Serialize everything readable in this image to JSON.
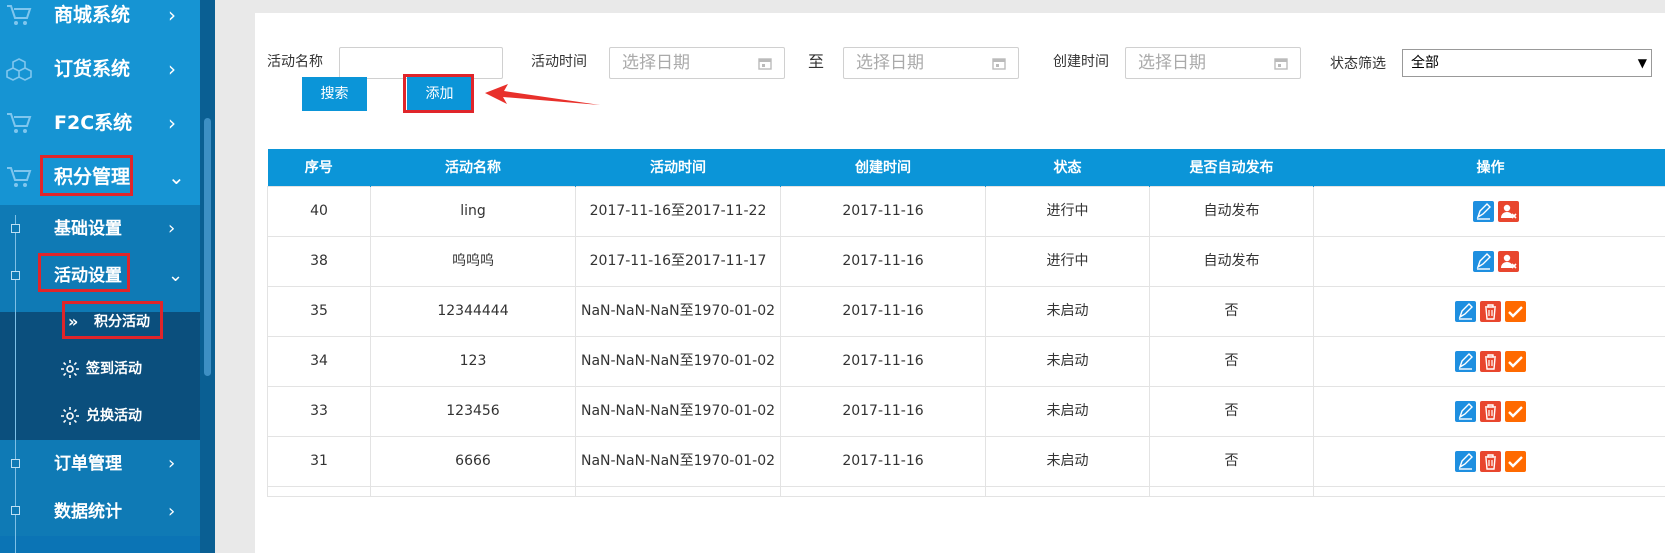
{
  "sidebar": {
    "items": [
      {
        "label": "商城系统",
        "arrow": "›",
        "icon": "cart-icon"
      },
      {
        "label": "订货系统",
        "arrow": "›",
        "icon": "cubes-icon"
      },
      {
        "label": "F2C系统",
        "arrow": "›",
        "icon": "cart-icon"
      },
      {
        "label": "积分管理",
        "arrow": "⌄",
        "icon": "cart-icon"
      }
    ],
    "subitems": [
      {
        "label": "基础设置",
        "arrow": "›"
      },
      {
        "label": "活动设置",
        "arrow": "⌄"
      }
    ],
    "activities": [
      {
        "label": "积分活动",
        "icon": "double-chevron-icon"
      },
      {
        "label": "签到活动",
        "icon": "gear-icon"
      },
      {
        "label": "兑换活动",
        "icon": "gear-icon"
      }
    ],
    "bottom_items": [
      {
        "label": "订单管理",
        "arrow": "›"
      },
      {
        "label": "数据统计",
        "arrow": "›"
      }
    ]
  },
  "filters": {
    "name_label": "活动名称",
    "name_value": "",
    "time_label": "活动时间",
    "date_placeholder": "选择日期",
    "to_label": "至",
    "created_label": "创建时间",
    "status_label": "状态筛选",
    "status_value": "全部"
  },
  "buttons": {
    "search": "搜索",
    "add": "添加"
  },
  "table": {
    "columns": [
      "序号",
      "活动名称",
      "活动时间",
      "创建时间",
      "状态",
      "是否自动发布",
      "操作"
    ],
    "rows": [
      {
        "id": "40",
        "name": "ling",
        "time": "2017-11-16至2017-11-22",
        "created": "2017-11-16",
        "status": "进行中",
        "auto": "自动发布",
        "ops": [
          "edit",
          "remove-user"
        ]
      },
      {
        "id": "38",
        "name": "呜呜呜",
        "time": "2017-11-16至2017-11-17",
        "created": "2017-11-16",
        "status": "进行中",
        "auto": "自动发布",
        "ops": [
          "edit",
          "remove-user"
        ]
      },
      {
        "id": "35",
        "name": "12344444",
        "time": "NaN-NaN-NaN至1970-01-02",
        "created": "2017-11-16",
        "status": "未启动",
        "auto": "否",
        "ops": [
          "edit",
          "delete",
          "confirm"
        ]
      },
      {
        "id": "34",
        "name": "123",
        "time": "NaN-NaN-NaN至1970-01-02",
        "created": "2017-11-16",
        "status": "未启动",
        "auto": "否",
        "ops": [
          "edit",
          "delete",
          "confirm"
        ]
      },
      {
        "id": "33",
        "name": "123456",
        "time": "NaN-NaN-NaN至1970-01-02",
        "created": "2017-11-16",
        "status": "未启动",
        "auto": "否",
        "ops": [
          "edit",
          "delete",
          "confirm"
        ]
      },
      {
        "id": "31",
        "name": "6666",
        "time": "NaN-NaN-NaN至1970-01-02",
        "created": "2017-11-16",
        "status": "未启动",
        "auto": "否",
        "ops": [
          "edit",
          "delete",
          "confirm"
        ]
      }
    ]
  },
  "colors": {
    "sidebar": "#0b74b5",
    "header_blue": "#0b95d8",
    "highlight_red": "#e0252a",
    "edit_blue": "#1e8fe0",
    "delete_red": "#e8462e",
    "confirm_orange": "#ff6a00"
  }
}
